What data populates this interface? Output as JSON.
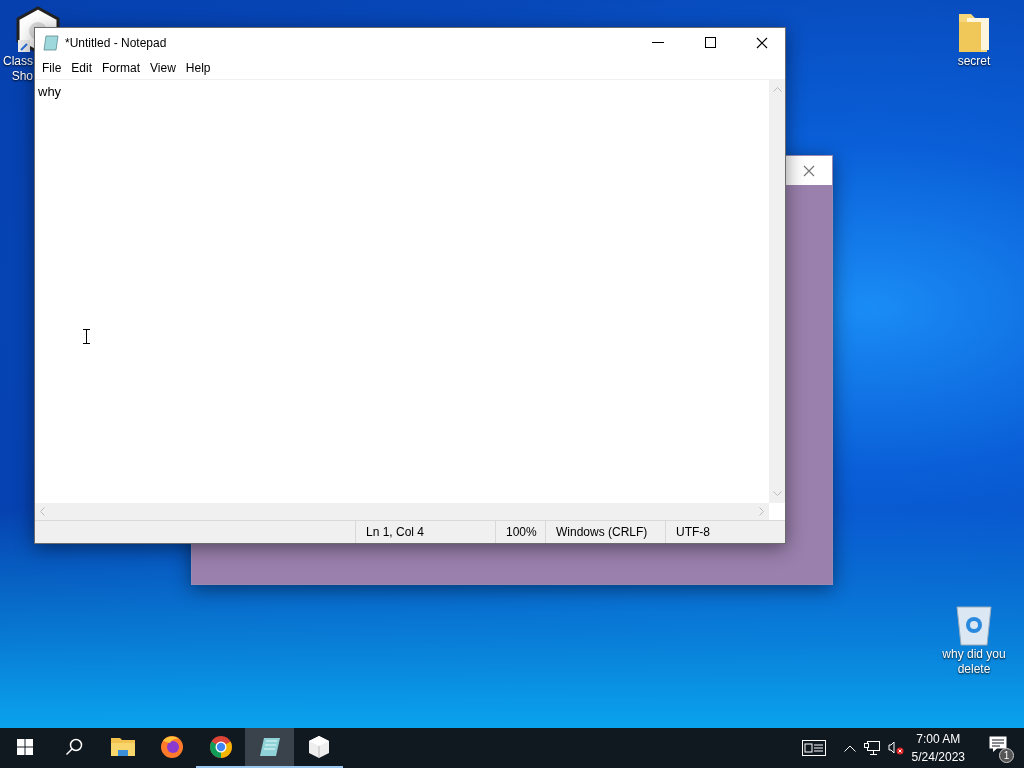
{
  "desktop_icons": [
    {
      "kind": "app",
      "lines": [
        "Class",
        "Sho"
      ]
    },
    {
      "kind": "folder",
      "lines": [
        "secret"
      ]
    },
    {
      "kind": "bin",
      "lines": [
        "why did you",
        "delete"
      ]
    }
  ],
  "notepad": {
    "title": "*Untitled - Notepad",
    "menu": [
      "File",
      "Edit",
      "Format",
      "View",
      "Help"
    ],
    "content": "why",
    "status": [
      "Ln 1, Col 4",
      "100%",
      "Windows (CRLF)",
      "UTF-8"
    ]
  },
  "taskbar": {
    "apps": [
      {
        "kind": "start",
        "running": false,
        "selected": false
      },
      {
        "kind": "search",
        "running": false,
        "selected": false
      },
      {
        "kind": "explorer",
        "running": false,
        "selected": false
      },
      {
        "kind": "firefox",
        "running": false,
        "selected": false
      },
      {
        "kind": "chrome",
        "running": true,
        "selected": false
      },
      {
        "kind": "notepad",
        "running": true,
        "selected": true
      },
      {
        "kind": "cube",
        "running": true,
        "selected": false
      }
    ],
    "time": "7:00 AM",
    "date": "5/24/2023",
    "notifications": "1"
  }
}
